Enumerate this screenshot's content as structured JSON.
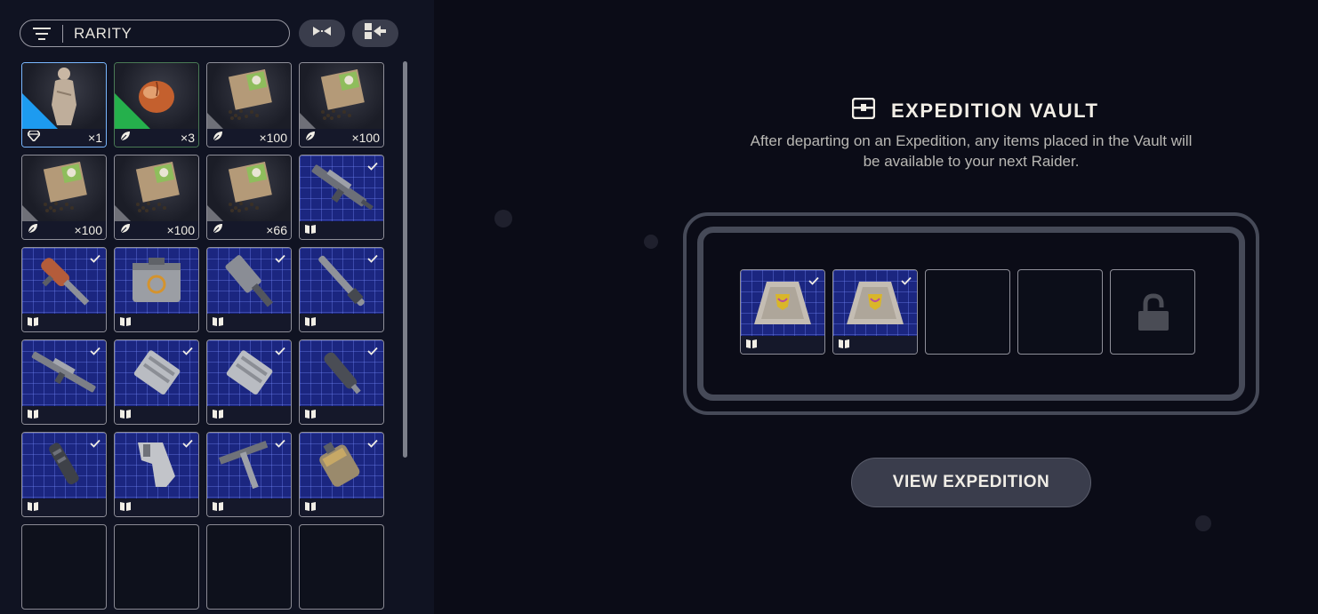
{
  "filter": {
    "label": "RARITY",
    "icon": "filter-icon"
  },
  "toolbar": {
    "collapse_icon": "collapse-arrows-icon",
    "move_icon": "move-to-left-icon"
  },
  "inventory": {
    "items": [
      {
        "name": "statue",
        "bg": "dark",
        "rarity_color": "#1d9bf0",
        "footer_icon": "diamond-icon",
        "qty": "×1",
        "checked": false
      },
      {
        "name": "peach",
        "bg": "dark",
        "rarity_color": "#25b04c",
        "footer_icon": "leaf-icon",
        "qty": "×3",
        "checked": false
      },
      {
        "name": "seed-packet",
        "bg": "dark",
        "rarity_color": "#6f7078",
        "footer_icon": "leaf-icon",
        "qty": "×100",
        "checked": false
      },
      {
        "name": "seed-packet",
        "bg": "dark",
        "rarity_color": "#6f7078",
        "footer_icon": "leaf-icon",
        "qty": "×100",
        "checked": false
      },
      {
        "name": "seed-packet",
        "bg": "dark",
        "rarity_color": "#6f7078",
        "footer_icon": "leaf-icon",
        "qty": "×100",
        "checked": false
      },
      {
        "name": "seed-packet",
        "bg": "dark",
        "rarity_color": "#6f7078",
        "footer_icon": "leaf-icon",
        "qty": "×100",
        "checked": false
      },
      {
        "name": "seed-packet",
        "bg": "dark",
        "rarity_color": "#6f7078",
        "footer_icon": "leaf-icon",
        "qty": "×66",
        "checked": false
      },
      {
        "name": "rifle-blueprint",
        "bg": "blueprint",
        "footer_icon": "blueprint-book-icon",
        "qty": "",
        "checked": true
      },
      {
        "name": "launcher-blueprint",
        "bg": "blueprint",
        "footer_icon": "blueprint-book-icon",
        "qty": "",
        "checked": true
      },
      {
        "name": "crate-blueprint",
        "bg": "blueprint",
        "footer_icon": "blueprint-book-icon",
        "qty": "",
        "checked": false
      },
      {
        "name": "heavy-gun-blueprint",
        "bg": "blueprint",
        "footer_icon": "blueprint-book-icon",
        "qty": "",
        "checked": true
      },
      {
        "name": "barrel-blueprint",
        "bg": "blueprint",
        "footer_icon": "blueprint-book-icon",
        "qty": "",
        "checked": true
      },
      {
        "name": "long-rifle-blueprint",
        "bg": "blueprint",
        "footer_icon": "blueprint-book-icon",
        "qty": "",
        "checked": true
      },
      {
        "name": "magazine-blueprint",
        "bg": "blueprint",
        "footer_icon": "blueprint-book-icon",
        "qty": "",
        "checked": true
      },
      {
        "name": "magazine-blueprint",
        "bg": "blueprint",
        "footer_icon": "blueprint-book-icon",
        "qty": "",
        "checked": true
      },
      {
        "name": "suppressor-blueprint",
        "bg": "blueprint",
        "footer_icon": "blueprint-book-icon",
        "qty": "",
        "checked": true
      },
      {
        "name": "muzzle-blueprint",
        "bg": "blueprint",
        "footer_icon": "blueprint-book-icon",
        "qty": "",
        "checked": true
      },
      {
        "name": "stock-blueprint",
        "bg": "blueprint",
        "footer_icon": "blueprint-book-icon",
        "qty": "",
        "checked": true
      },
      {
        "name": "tool-blueprint",
        "bg": "blueprint",
        "footer_icon": "blueprint-book-icon",
        "qty": "",
        "checked": true
      },
      {
        "name": "grenade-blueprint",
        "bg": "blueprint",
        "footer_icon": "blueprint-book-icon",
        "qty": "",
        "checked": true
      },
      {
        "name": "empty",
        "bg": "empty"
      },
      {
        "name": "empty",
        "bg": "empty"
      },
      {
        "name": "empty",
        "bg": "empty"
      },
      {
        "name": "empty",
        "bg": "empty"
      }
    ]
  },
  "vault": {
    "title": "EXPEDITION VAULT",
    "icon": "vault-chest-icon",
    "description": "After departing on an Expedition, any items placed in the Vault will be available to your next Raider.",
    "slots": [
      {
        "state": "item",
        "name": "shield-case-blueprint",
        "checked": true
      },
      {
        "state": "item",
        "name": "shield-case-blueprint",
        "checked": true
      },
      {
        "state": "empty"
      },
      {
        "state": "empty"
      },
      {
        "state": "locked",
        "icon": "padlock-icon"
      }
    ]
  },
  "view_button": {
    "label": "VIEW EXPEDITION"
  }
}
